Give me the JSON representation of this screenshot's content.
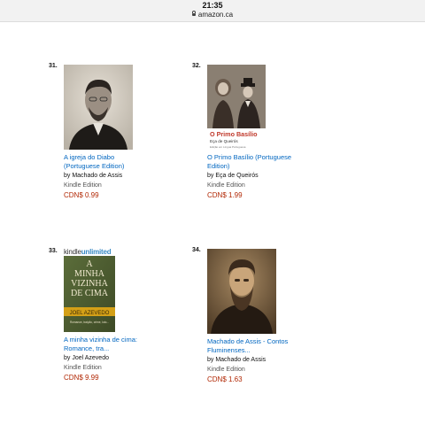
{
  "status_bar": {
    "time": "21:35",
    "url": "amazon.ca"
  },
  "products": [
    {
      "rank": "31.",
      "title_line1": "A igreja do Diabo",
      "title_line2": "(Portuguese Edition)",
      "author": "by Machado de Assis",
      "format": "Kindle Edition",
      "price": "CDN$ 0.99"
    },
    {
      "rank": "32.",
      "title_line1": "O Primo Basílio (Portuguese",
      "title_line2": "Edition)",
      "author": "by Eça de Queirós",
      "format": "Kindle Edition",
      "price": "CDN$ 1.99",
      "cover_title": "O Primo Basílio",
      "cover_author": "Eça de Queirós",
      "cover_subtitle": "Edição em Língua Portuguesa"
    },
    {
      "rank": "33.",
      "title_line1": "A minha vizinha de cima:",
      "title_line2": "Romance, tra...",
      "author": "by Joel Azevedo",
      "format": "Kindle Edition",
      "price": "CDN$ 9.99",
      "badge_left": "kindle",
      "badge_right": "unlimited",
      "cover_title_1": "A",
      "cover_title_2": "MINHA",
      "cover_title_3": "VIZINHA",
      "cover_title_4": "DE CIMA",
      "cover_author": "JOEL AZEVEDO",
      "cover_tagline": "Romance, traição, crime, luto..."
    },
    {
      "rank": "34.",
      "title_line1": "Machado de Assis - Contos",
      "title_line2": "Fluminenses...",
      "author": "by Machado de Assis",
      "format": "Kindle Edition",
      "price": "CDN$ 1.63"
    }
  ],
  "colors": {
    "link": "#0066c0",
    "price": "#b12704",
    "kindle_unlimited": "#3a8ac4"
  }
}
